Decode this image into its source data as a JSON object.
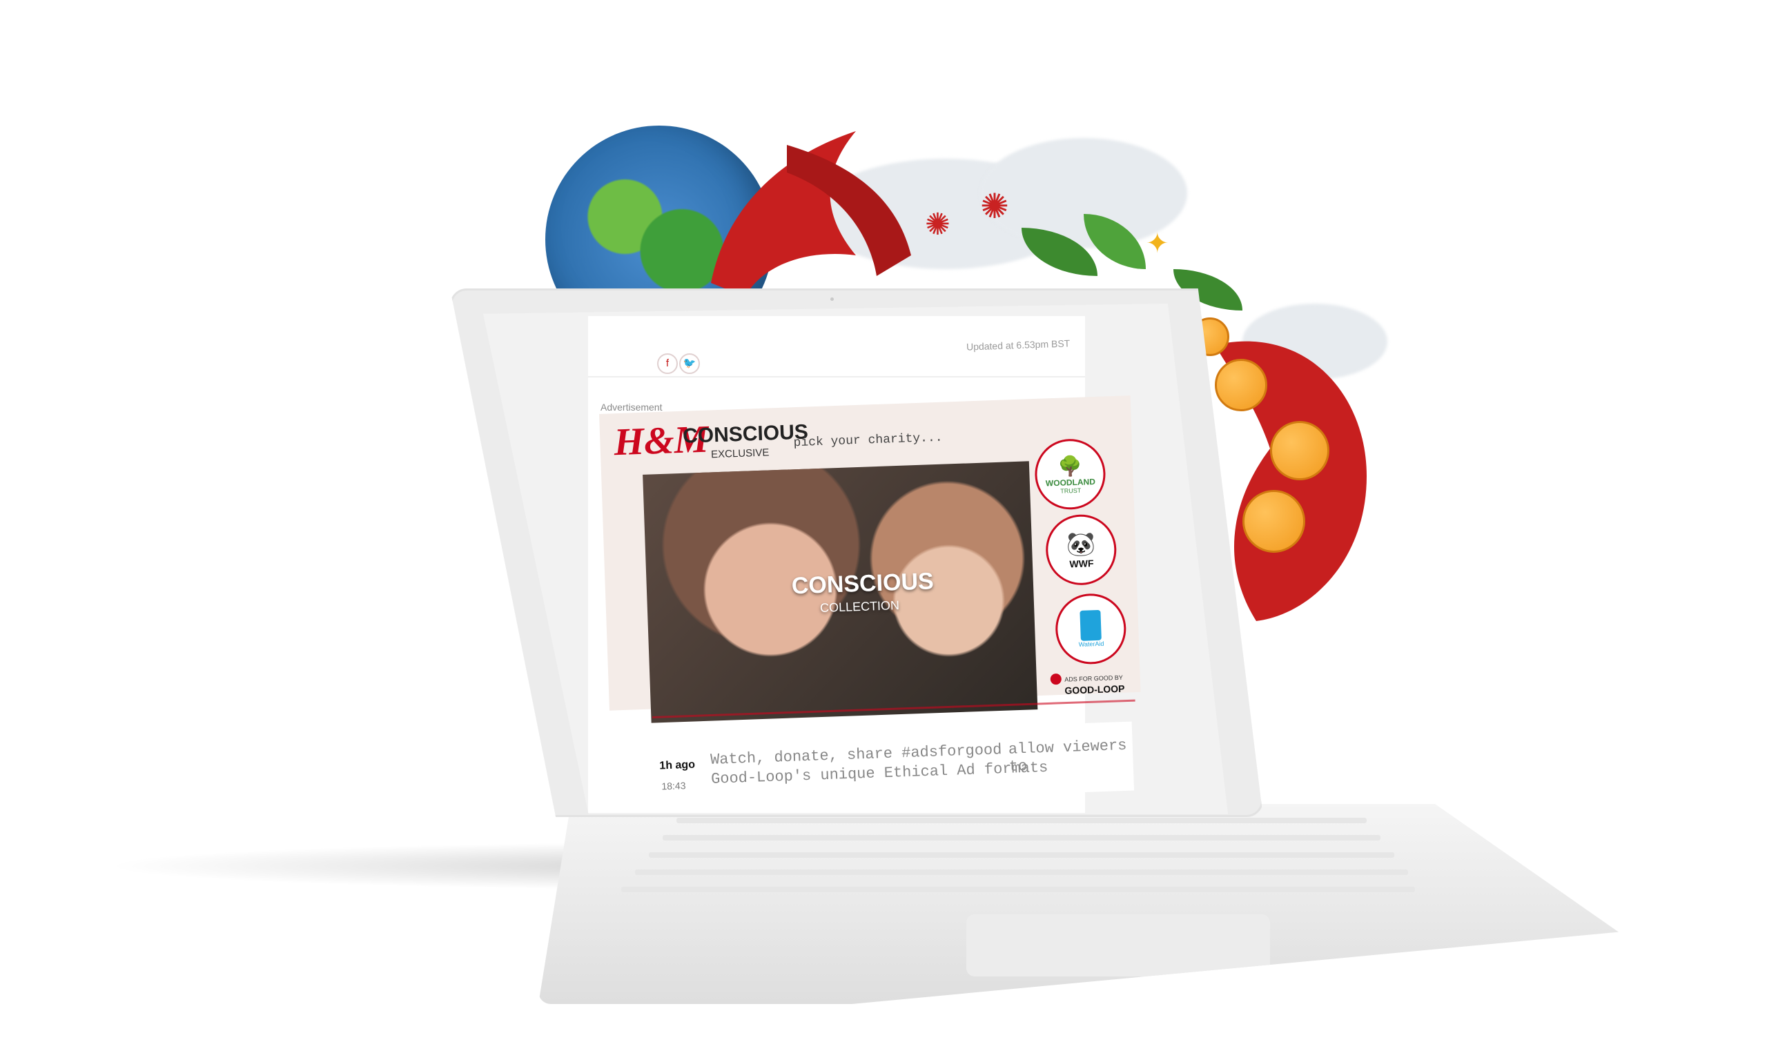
{
  "page": {
    "updated_text": "Updated at 6.53pm BST",
    "share_icons": [
      "facebook-icon",
      "twitter-icon"
    ]
  },
  "ad": {
    "label": "Advertisement",
    "brand": "H&M",
    "title": "CONSCIOUS",
    "subtitle": "EXCLUSIVE",
    "prompt": "pick your charity...",
    "overlay_title": "CONSCIOUS",
    "overlay_subtitle": "COLLECTION",
    "charities": [
      {
        "name": "WOODLAND",
        "sub": "TRUST"
      },
      {
        "name": "WWF",
        "sub": ""
      },
      {
        "name": "WaterAid",
        "sub": ""
      }
    ],
    "footer_small": "ADS FOR GOOD BY",
    "footer_brand": "GOOD-LOOP",
    "accent": "#cc071e"
  },
  "feed": {
    "time_ago": "1h ago",
    "time": "18:43",
    "line1": "Watch, donate, share #adsforgood",
    "line2_a": "allow viewers to",
    "line2_b": "Good-Loop's unique Ethical Ad formats"
  }
}
